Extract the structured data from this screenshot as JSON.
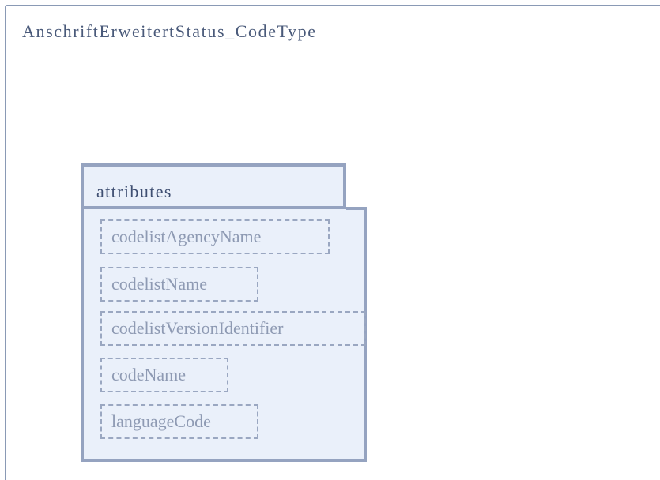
{
  "diagram": {
    "type_name": "AnschriftErweitertStatus_CodeType",
    "attributes_group": {
      "label": "attributes",
      "items": [
        "codelistAgencyName",
        "codelistName",
        "codelistVersionIdentifier",
        "codeName",
        "languageCode"
      ]
    }
  },
  "colors": {
    "frame_border": "#8a9ab5",
    "group_fill": "#eaf0fa",
    "group_border": "#95a3c0",
    "title_text": "#4a5a7a",
    "attribute_text": "#8e9ab3"
  }
}
